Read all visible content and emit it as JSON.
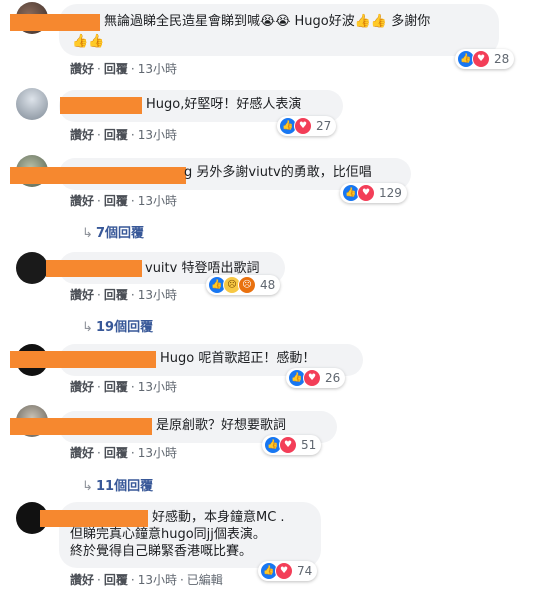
{
  "colors": {
    "bubble": "#f2f3f5",
    "link": "#385898",
    "redaction": "#f6882f",
    "like": "#1877f2",
    "love": "#f33e58"
  },
  "labels": {
    "like": "讚好",
    "reply": "回覆"
  },
  "comments": [
    {
      "line1": "無論過睇全民造星會睇到喊😭😭 Hugo好波👍👍 多謝你",
      "line2": "👍👍",
      "time": "13小時",
      "reaction_count": "28",
      "reactions": [
        "like",
        "love"
      ]
    },
    {
      "text": "Hugo,好堅呀！好感人表演",
      "time": "13小時",
      "reaction_count": "27",
      "reactions": [
        "like",
        "love"
      ]
    },
    {
      "text": "g 另外多謝viutv的勇敢，比佢唱",
      "time": "13小時",
      "reaction_count": "129",
      "reactions": [
        "like",
        "love"
      ],
      "replies": "7個回覆"
    },
    {
      "text": "vuitv 特登唔出歌詞",
      "time": "13小時",
      "reaction_count": "48",
      "reactions": [
        "like",
        "sad",
        "angry"
      ],
      "replies": "19個回覆"
    },
    {
      "text": "Hugo 呢首歌超正！感動！",
      "time": "13小時",
      "reaction_count": "26",
      "reactions": [
        "like",
        "love"
      ]
    },
    {
      "text": "是原創歌？好想要歌詞",
      "time": "13小時",
      "reaction_count": "51",
      "reactions": [
        "like",
        "love"
      ],
      "replies": "11個回覆"
    },
    {
      "line1": "好感動，本身鐘意MC .",
      "line2": "但睇完真心鐘意hugo同jj個表演。",
      "line3": "終於覺得自己睇緊香港嘅比賽。",
      "time": "13小時",
      "edited": "已編輯",
      "reaction_count": "74",
      "reactions": [
        "like",
        "love"
      ]
    }
  ]
}
